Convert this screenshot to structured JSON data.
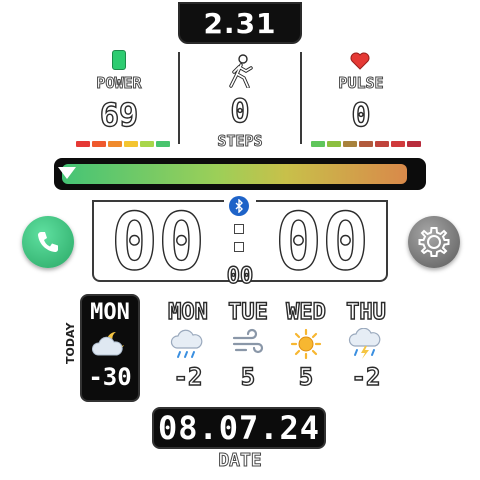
{
  "top": {
    "value": "2.31"
  },
  "power": {
    "label": "POWER",
    "value": "69",
    "color": "#2ecc71"
  },
  "steps": {
    "label": "STEPS",
    "value": "0"
  },
  "pulse": {
    "label": "PULSE",
    "value": "0",
    "color": "#e53935"
  },
  "power_scale": [
    "#e53935",
    "#ef5a2e",
    "#f08a2c",
    "#f4c531",
    "#a8d64a",
    "#49c46e"
  ],
  "pulse_scale": [
    "#5fc65a",
    "#8cbf3f",
    "#a8823c",
    "#b25a3c",
    "#c0443c",
    "#d03a3c",
    "#b82c3c"
  ],
  "progress": {
    "fraction": 0.97
  },
  "clock": {
    "hours": "00",
    "minutes": "00",
    "seconds": "00"
  },
  "today": {
    "tag": "TODAY",
    "day": "MON",
    "temp": "-30",
    "icon": "night-cloud-icon"
  },
  "forecast": [
    {
      "day": "MON",
      "temp": "-2",
      "icon": "rain-cloud-icon"
    },
    {
      "day": "TUE",
      "temp": "5",
      "icon": "wind-icon"
    },
    {
      "day": "WED",
      "temp": "5",
      "icon": "sun-icon"
    },
    {
      "day": "THU",
      "temp": "-2",
      "icon": "thunder-rain-icon"
    }
  ],
  "date": {
    "value": "08.07.24",
    "label": "DATE"
  }
}
